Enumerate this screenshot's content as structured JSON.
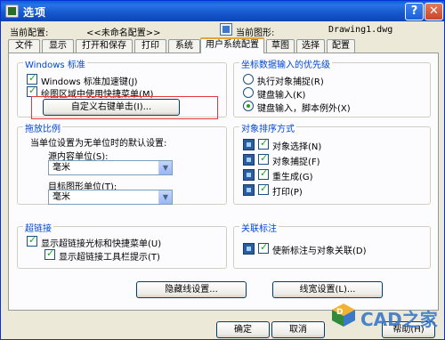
{
  "window": {
    "title": "选项",
    "help_btn": "?",
    "close_btn": "✕"
  },
  "profile": {
    "label": "当前配置:",
    "value": "<<未命名配置>>"
  },
  "drawing": {
    "label": "当前图形:",
    "value": "Drawing1.dwg"
  },
  "tabs": [
    "文件",
    "显示",
    "打开和保存",
    "打印",
    "系统",
    "用户系统配置",
    "草图",
    "选择",
    "配置"
  ],
  "windows_group": {
    "title": "Windows 标准",
    "items": [
      {
        "label": "Windows 标准加速键(J)",
        "checked": true
      },
      {
        "label": "绘图区域中使用快捷菜单(M)",
        "checked": true
      }
    ],
    "button": "自定义右键单击(I)..."
  },
  "coord_group": {
    "title": "坐标数据输入的优先级",
    "options": [
      {
        "label": "执行对象捕捉(R)",
        "checked": false
      },
      {
        "label": "键盘输入(K)",
        "checked": false
      },
      {
        "label": "键盘输入，脚本例外(X)",
        "checked": true
      }
    ]
  },
  "scale_group": {
    "title": "拖放比例",
    "desc": "当单位设置为无单位时的默认设置:",
    "source_label": "源内容单位(S):",
    "source_value": "毫米",
    "target_label": "目标图形单位(T):",
    "target_value": "毫米"
  },
  "sort_group": {
    "title": "对象排序方式",
    "items": [
      {
        "label": "对象选择(N)",
        "checked": true
      },
      {
        "label": "对象捕捉(F)",
        "checked": true
      },
      {
        "label": "重生成(G)",
        "checked": true
      },
      {
        "label": "打印(P)",
        "checked": true
      }
    ]
  },
  "hyperlink_group": {
    "title": "超链接",
    "items": [
      {
        "label": "显示超链接光标和快捷菜单(U)",
        "checked": true
      },
      {
        "label": "显示超链接工具栏提示(T)",
        "checked": true
      }
    ]
  },
  "assoc_group": {
    "title": "关联标注",
    "item": {
      "label": "使新标注与对象关联(D)",
      "checked": true
    }
  },
  "panel_buttons": {
    "hidden_line": "隐藏线设置...",
    "lineweight": "线宽设置(L)..."
  },
  "dialog_buttons": {
    "ok": "确定",
    "cancel": "取消",
    "help": "帮助(H)"
  },
  "watermark": {
    "text": "CAD之家"
  }
}
